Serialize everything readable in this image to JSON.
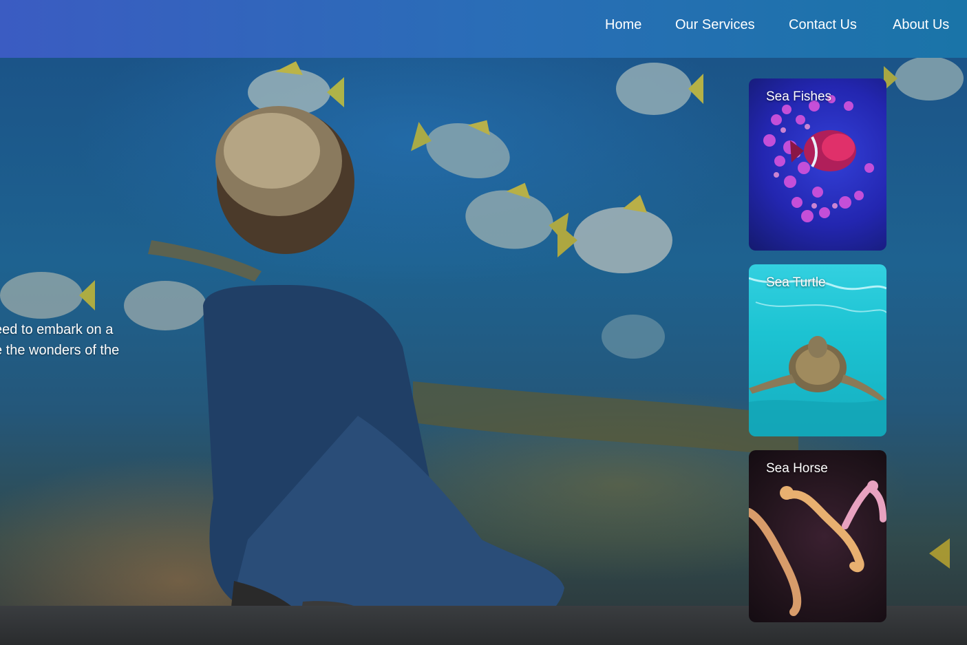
{
  "nav": {
    "items": [
      {
        "label": "Home"
      },
      {
        "label": "Our Services"
      },
      {
        "label": "Contact Us"
      },
      {
        "label": "About Us"
      }
    ],
    "gradient_colors": [
      "#3b5cc2",
      "#1a74a8"
    ]
  },
  "hero": {
    "text_lines": [
      "eed to embark on a",
      "e the wonders of the"
    ]
  },
  "cards": [
    {
      "title": "Sea Fishes"
    },
    {
      "title": "Sea Turtle"
    },
    {
      "title": "Sea Horse"
    }
  ]
}
